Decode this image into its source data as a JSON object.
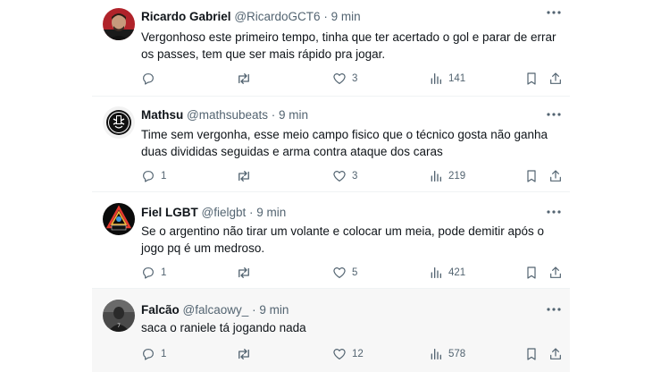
{
  "tweets": [
    {
      "name": "Ricardo Gabriel",
      "handle": "@RicardoGCT6",
      "dot": "·",
      "time": "9 min",
      "text": "Vergonhoso este primeiro tempo, tinha que ter acertado o gol e parar de errar os passes, tem que ser mais rápido pra jogar.",
      "replies": "",
      "retweets": "",
      "likes": "3",
      "views": "141",
      "avatar_icon": "user-photo-avatar",
      "avatar_color": "#b0232a"
    },
    {
      "name": "Mathsu",
      "handle": "@mathsubeats",
      "dot": "·",
      "time": "9 min",
      "text": "Time sem vergonha, esse meio campo fisico que o técnico gosta não ganha duas divididas seguidas e arma contra ataque dos caras",
      "replies": "1",
      "retweets": "",
      "likes": "3",
      "views": "219",
      "avatar_icon": "corinthians-badge-avatar",
      "avatar_color": "#111111"
    },
    {
      "name": "Fiel LGBT",
      "handle": "@fielgbt",
      "dot": "·",
      "time": "9 min",
      "text": "Se o argentino não tirar um volante e colocar um meia, pode demitir após o jogo pq é um medroso.",
      "replies": "1",
      "retweets": "",
      "likes": "5",
      "views": "421",
      "avatar_icon": "rainbow-logo-avatar",
      "avatar_color": "#0b0b0b"
    },
    {
      "name": "Falcão",
      "handle": "@falcaowy_",
      "dot": "·",
      "time": "9 min",
      "text": "saca o raniele tá jogando nada",
      "replies": "1",
      "retweets": "",
      "likes": "12",
      "views": "578",
      "avatar_icon": "player-photo-avatar",
      "avatar_color": "#3a3a3a"
    }
  ],
  "colors": {
    "text": "#0f1419",
    "secondary": "#536471",
    "border": "#eff3f4",
    "highlight": "#f7f7f7"
  }
}
